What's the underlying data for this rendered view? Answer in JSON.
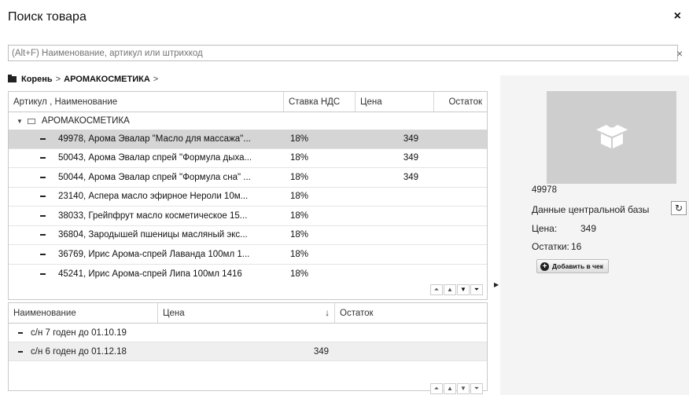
{
  "dialog": {
    "title": "Поиск товара"
  },
  "search": {
    "placeholder": "(Alt+F) Наименование, артикул или штрихкод",
    "clear": "×"
  },
  "breadcrumb": {
    "root": "Корень",
    "sep1": ">",
    "current": "АРОМАКОСМЕТИКА",
    "sep2": ">"
  },
  "products": {
    "columns": [
      "Артикул , Наименование",
      "Ставка НДС",
      "Цена",
      "Остаток"
    ],
    "group": "АРОМАКОСМЕТИКА",
    "rows": [
      {
        "name": "49978, Арома Эвалар \"Масло для массажа\"...",
        "vat": "18%",
        "price": "349"
      },
      {
        "name": "50043, Арома Эвалар спрей \"Формула дыха...",
        "vat": "18%",
        "price": "349"
      },
      {
        "name": "50044, Арома Эвалар спрей \"Формула сна\" ...",
        "vat": "18%",
        "price": "349"
      },
      {
        "name": "23140, Аспера масло эфирное Нероли 10м...",
        "vat": "18%",
        "price": ""
      },
      {
        "name": "38033, Грейпфрут  масло косметическое 15...",
        "vat": "18%",
        "price": ""
      },
      {
        "name": "36804, Зародышей пшеницы масляный экс...",
        "vat": "18%",
        "price": ""
      },
      {
        "name": "36769, Ирис Арома-спрей Лаванда 100мл 1...",
        "vat": "18%",
        "price": ""
      },
      {
        "name": "45241, Ирис Арома-спрей Липа 100мл 1416",
        "vat": "18%",
        "price": ""
      }
    ]
  },
  "batches": {
    "columns": [
      "Наименование",
      "Цена",
      "↓",
      "Остаток"
    ],
    "rows": [
      {
        "name": "с/н 7 годен до 01.10.19",
        "price": ""
      },
      {
        "name": "с/н 6 годен до 01.12.18",
        "price": "349"
      }
    ]
  },
  "details": {
    "article": "49978",
    "central_db": "Данные центральной базы",
    "price_label": "Цена:",
    "price": "349",
    "stock_label": "Остатки:",
    "stock": "16",
    "add_button": "Добавить в чек"
  }
}
